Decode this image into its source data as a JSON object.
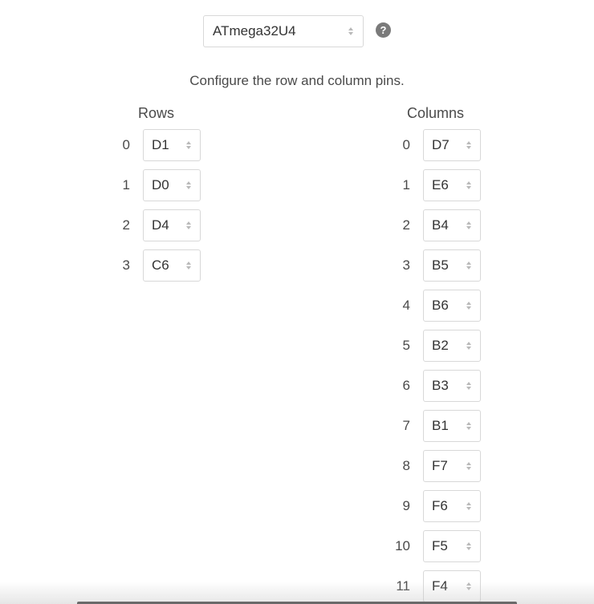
{
  "mcu": {
    "selected": "ATmega32U4"
  },
  "help": {
    "icon": "question-circle-icon",
    "glyph": "?"
  },
  "instructions": "Configure the row and column pins.",
  "rows": {
    "heading": "Rows",
    "items": [
      {
        "index": "0",
        "pin": "D1"
      },
      {
        "index": "1",
        "pin": "D0"
      },
      {
        "index": "2",
        "pin": "D4"
      },
      {
        "index": "3",
        "pin": "C6"
      }
    ]
  },
  "columns": {
    "heading": "Columns",
    "items": [
      {
        "index": "0",
        "pin": "D7"
      },
      {
        "index": "1",
        "pin": "E6"
      },
      {
        "index": "2",
        "pin": "B4"
      },
      {
        "index": "3",
        "pin": "B5"
      },
      {
        "index": "4",
        "pin": "B6"
      },
      {
        "index": "5",
        "pin": "B2"
      },
      {
        "index": "6",
        "pin": "B3"
      },
      {
        "index": "7",
        "pin": "B1"
      },
      {
        "index": "8",
        "pin": "F7"
      },
      {
        "index": "9",
        "pin": "F6"
      },
      {
        "index": "10",
        "pin": "F5"
      },
      {
        "index": "11",
        "pin": "F4"
      }
    ]
  }
}
